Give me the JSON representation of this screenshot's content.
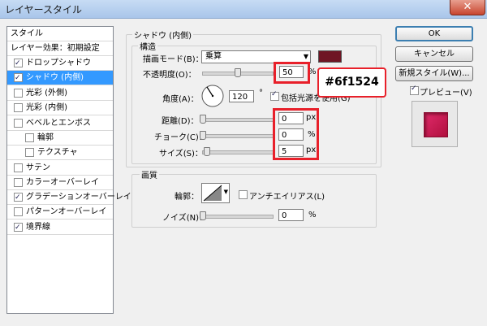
{
  "window": {
    "title": "レイヤースタイル",
    "close_icon": "close-icon"
  },
  "left_panel": {
    "items": [
      {
        "label": "スタイル",
        "checkbox": false,
        "checked": false,
        "selected": false
      },
      {
        "label": "レイヤー効果：初期設定",
        "checkbox": false,
        "checked": false,
        "selected": false
      },
      {
        "label": "ドロップシャドウ",
        "checkbox": true,
        "checked": true,
        "selected": false
      },
      {
        "label": "シャドウ (内側)",
        "checkbox": true,
        "checked": true,
        "selected": true
      },
      {
        "label": "光彩 (外側)",
        "checkbox": true,
        "checked": false,
        "selected": false
      },
      {
        "label": "光彩 (内側)",
        "checkbox": true,
        "checked": false,
        "selected": false
      },
      {
        "label": "ベベルとエンボス",
        "checkbox": true,
        "checked": false,
        "selected": false
      },
      {
        "label": "輪郭",
        "checkbox": true,
        "checked": false,
        "selected": false
      },
      {
        "label": "テクスチャ",
        "checkbox": true,
        "checked": false,
        "selected": false
      },
      {
        "label": "サテン",
        "checkbox": true,
        "checked": false,
        "selected": false
      },
      {
        "label": "カラーオーバーレイ",
        "checkbox": true,
        "checked": false,
        "selected": false
      },
      {
        "label": "グラデーションオーバーレイ",
        "checkbox": true,
        "checked": true,
        "selected": false
      },
      {
        "label": "パターンオーバーレイ",
        "checkbox": true,
        "checked": false,
        "selected": false
      },
      {
        "label": "境界線",
        "checkbox": true,
        "checked": true,
        "selected": false
      }
    ]
  },
  "shadow_group": {
    "title": "シャドウ (内側)",
    "structure_title": "構造",
    "blend_mode_label": "描画モード(B)：",
    "blend_mode_value": "乗算",
    "blend_color": "#6f1524",
    "opacity_label": "不透明度(O)：",
    "opacity_value": "50",
    "opacity_unit": "%",
    "opacity_level": 0.5,
    "angle_label": "角度(A)：",
    "angle_value": "120",
    "angle_unit": "°",
    "global_light_label": "包括光源を使用(G)",
    "global_light_checked": true,
    "distance_label": "距離(D)：",
    "distance_value": "0",
    "distance_unit": "px",
    "choke_label": "チョーク(C)：",
    "choke_value": "0",
    "choke_unit": "%",
    "size_label": "サイズ(S)：",
    "size_value": "5",
    "size_unit": "px"
  },
  "quality_group": {
    "title": "画質",
    "contour_label": "輪郭：",
    "antialias_label": "アンチエイリアス(L)",
    "antialias_checked": false,
    "noise_label": "ノイズ(N)：",
    "noise_value": "0",
    "noise_unit": "%"
  },
  "callout_text": "#6f1524",
  "buttons": {
    "ok": "OK",
    "cancel": "キャンセル",
    "new_style": "新規スタイル(W)...",
    "preview_label": "プレビュー(V)",
    "preview_checked": true
  },
  "preview_color": "#c41450"
}
